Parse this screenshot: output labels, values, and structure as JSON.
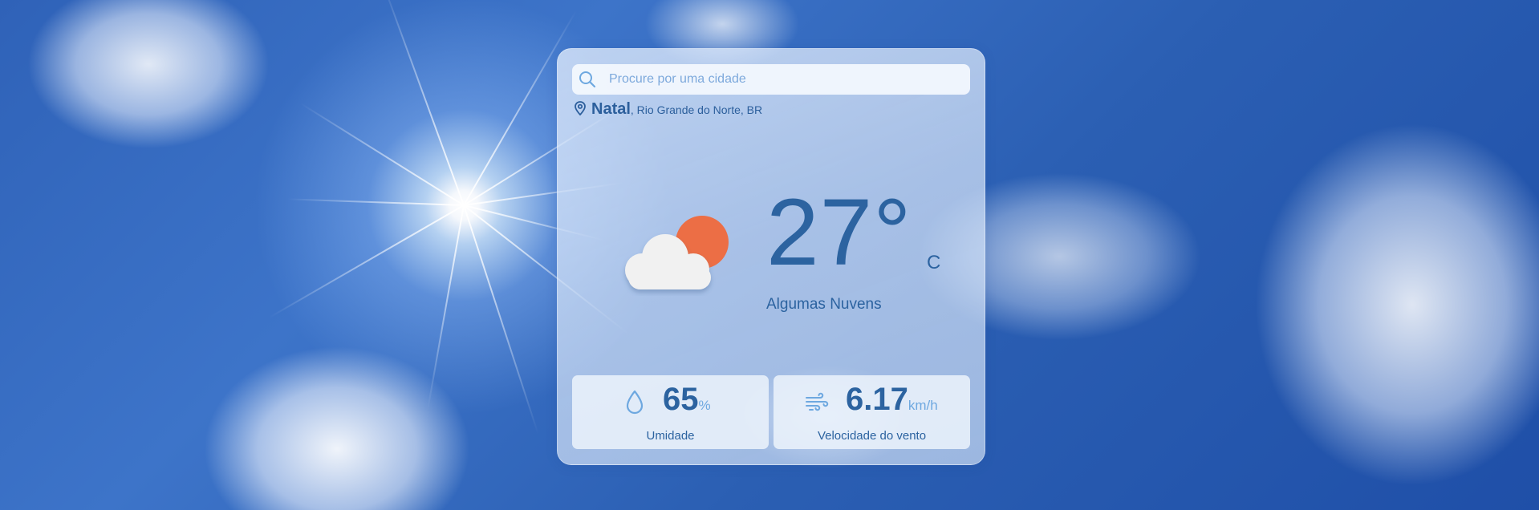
{
  "search": {
    "placeholder": "Procure por uma cidade",
    "icon": "search-icon"
  },
  "location": {
    "icon": "map-pin-icon",
    "city": "Natal",
    "region": ", Rio Grande do Norte, BR"
  },
  "current": {
    "icon": "partly-cloudy-icon",
    "temperature": "27°",
    "unit": "C",
    "condition": "Algumas Nuvens"
  },
  "stats": {
    "humidity": {
      "icon": "water-drop-icon",
      "value": "65",
      "unit": "%",
      "label": "Umidade"
    },
    "wind": {
      "icon": "wind-icon",
      "value": "6.17",
      "unit": "km/h",
      "label": "Velocidade do vento"
    }
  },
  "colors": {
    "accent": "#2c63a0",
    "sun": "#ec6e45",
    "icon_blue": "#6ea8e0",
    "sky": "#2f62b8"
  }
}
